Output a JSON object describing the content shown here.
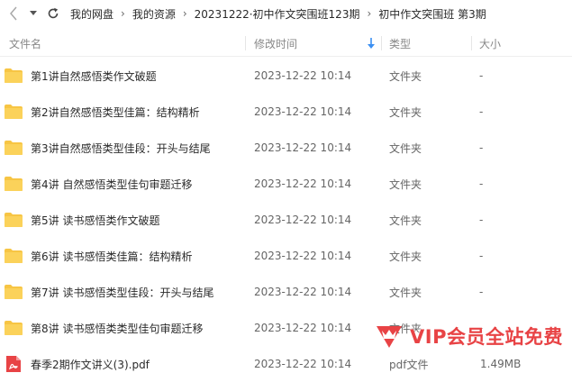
{
  "toolbar": {
    "back_icon": "chevron-left-icon",
    "dropdown_icon": "caret-down-icon",
    "refresh_icon": "refresh-icon"
  },
  "breadcrumb": [
    "我的网盘",
    "我的资源",
    "20231222·初中作文突围班123期",
    "初中作文突围班 第3期"
  ],
  "table": {
    "columns": {
      "name": "文件名",
      "mtime": "修改时间",
      "type": "类型",
      "size": "大小"
    },
    "sort_icon": "sort-down-arrow-icon",
    "rows": [
      {
        "icon": "folder-icon",
        "name": "第1讲自然感悟类作文破题",
        "mtime": "2023-12-22 10:14",
        "type": "文件夹",
        "size": "-"
      },
      {
        "icon": "folder-icon",
        "name": "第2讲自然感悟类型佳篇：结构精析",
        "mtime": "2023-12-22 10:14",
        "type": "文件夹",
        "size": "-"
      },
      {
        "icon": "folder-icon",
        "name": "第3讲自然感悟类型佳段：开头与结尾",
        "mtime": "2023-12-22 10:14",
        "type": "文件夹",
        "size": "-"
      },
      {
        "icon": "folder-icon",
        "name": "第4讲 自然感悟类型佳句审题迁移",
        "mtime": "2023-12-22 10:14",
        "type": "文件夹",
        "size": "-"
      },
      {
        "icon": "folder-icon",
        "name": "第5讲 读书感悟类作文破题",
        "mtime": "2023-12-22 10:14",
        "type": "文件夹",
        "size": "-"
      },
      {
        "icon": "folder-icon",
        "name": "第6讲 读书感悟类佳篇：结构精析",
        "mtime": "2023-12-22 10:14",
        "type": "文件夹",
        "size": "-"
      },
      {
        "icon": "folder-icon",
        "name": "第7讲 读书感悟类型佳段：开头与结尾",
        "mtime": "2023-12-22 10:14",
        "type": "文件夹",
        "size": "-"
      },
      {
        "icon": "folder-icon",
        "name": "第8讲 读书感悟类类型佳句审题迁移",
        "mtime": "2023-12-22 10:14",
        "type": "文件夹",
        "size": "-"
      },
      {
        "icon": "pdf-file-icon",
        "name": "春季2期作文讲义(3).pdf",
        "mtime": "2023-12-22 10:14",
        "type": "pdf文件",
        "size": "1.49MB"
      }
    ]
  },
  "watermark": {
    "icon": "vip-crown-icon",
    "text": "VIP会员全站免费"
  },
  "colors": {
    "folder": "#f7c544",
    "pdf": "#e84345",
    "accent": "#3b8ff2",
    "watermark": "#e84345"
  }
}
